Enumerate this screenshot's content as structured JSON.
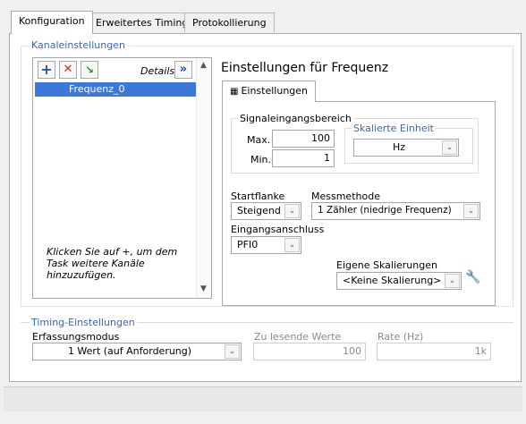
{
  "tabs": [
    {
      "label": "Konfiguration"
    },
    {
      "label": "Erweitertes Timing"
    },
    {
      "label": "Protokollierung"
    }
  ],
  "channel_group": {
    "title": "Kanaleinstellungen",
    "details_label": "Details",
    "selected_channel": "Frequenz_0",
    "hint": "Klicken Sie auf +, um dem Task weitere Kanäle hinzuzufügen."
  },
  "settings": {
    "heading": "Einstellungen für Frequenz",
    "subtab_label": "Einstellungen",
    "signal_range_title": "Signaleingangsbereich",
    "max_label": "Max.",
    "max_value": "100",
    "min_label": "Min.",
    "min_value": "1",
    "scaled_unit_title": "Skalierte Einheit",
    "scaled_unit_value": "Hz",
    "start_edge_label": "Startflanke",
    "start_edge_value": "Steigend",
    "method_label": "Messmethode",
    "method_value": "1 Zähler (niedrige Frequenz)",
    "input_terminal_label": "Eingangsanschluss",
    "input_terminal_value": "PFI0",
    "custom_scaling_label": "Eigene Skalierungen",
    "custom_scaling_value": "<Keine Skalierung>"
  },
  "timing": {
    "title": "Timing-Einstellungen",
    "mode_label": "Erfassungsmodus",
    "mode_value": "1 Wert (auf Anforderung)",
    "samples_label": "Zu lesende Werte",
    "samples_value": "100",
    "rate_label": "Rate (Hz)",
    "rate_value": "1k"
  },
  "colors": {
    "accent": "#3b66b5",
    "selection": "#3b78d8"
  }
}
